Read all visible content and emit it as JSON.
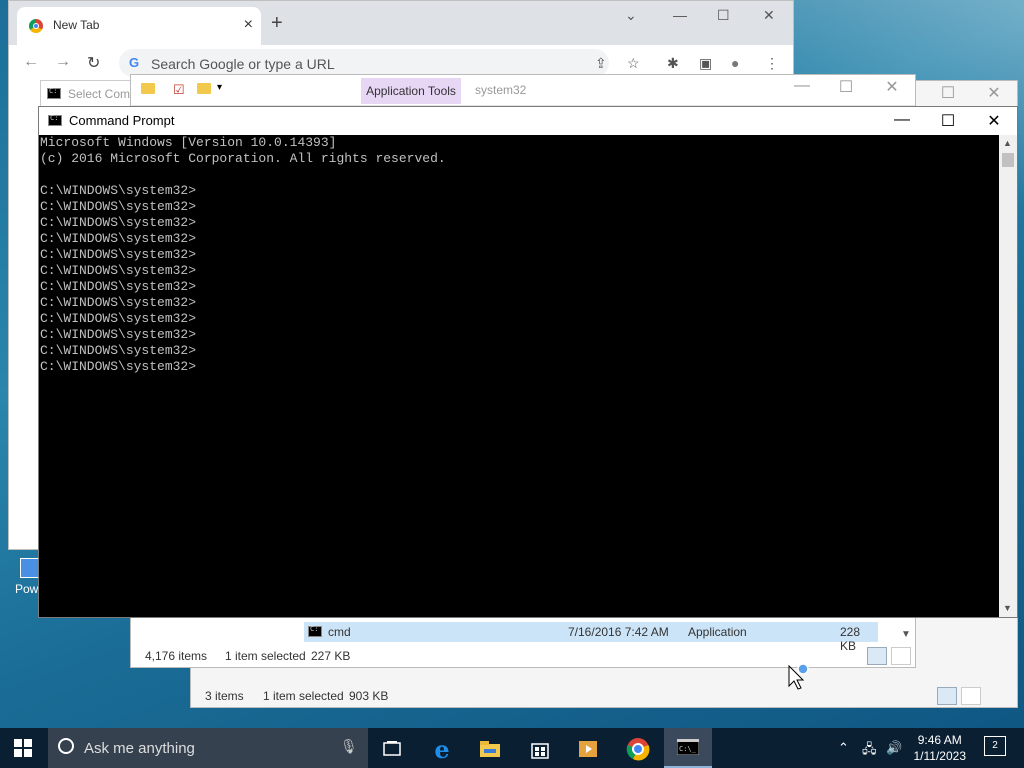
{
  "chrome": {
    "tab_title": "New Tab",
    "tab_close": "×",
    "new_tab": "+",
    "omnibox_placeholder": "Search Google or type a URL",
    "omnibox_g": "G",
    "minimize": "—",
    "maximize": "☐",
    "close": "✕",
    "chevron": "⌄",
    "back": "←",
    "forward": "→",
    "reload": "↻",
    "share": "⇪",
    "star": "☆",
    "extensions": "✱",
    "sidepanel": "▣",
    "profile": "●",
    "menu": "⋮"
  },
  "explorer_back": {
    "status_items": "3 items",
    "status_selected": "1 item selected",
    "status_size": "903 KB"
  },
  "explorer_front": {
    "ribbon_context_tab": "Application Tools",
    "ribbon_path_title": "system32",
    "status_items": "4,176 items",
    "status_selected": "1 item selected",
    "status_size": "227 KB",
    "row": {
      "name": "cmd",
      "date": "7/16/2016 7:42 AM",
      "type": "Application",
      "size": "228 KB"
    }
  },
  "select_command_title": "Select Com",
  "cmd": {
    "title": "Command Prompt",
    "minimize": "—",
    "maximize": "☐",
    "close": "✕",
    "lines": [
      "Microsoft Windows [Version 10.0.14393]",
      "(c) 2016 Microsoft Corporation. All rights reserved.",
      "",
      "C:\\WINDOWS\\system32>",
      "C:\\WINDOWS\\system32>",
      "C:\\WINDOWS\\system32>",
      "C:\\WINDOWS\\system32>",
      "C:\\WINDOWS\\system32>",
      "C:\\WINDOWS\\system32>",
      "C:\\WINDOWS\\system32>",
      "C:\\WINDOWS\\system32>",
      "C:\\WINDOWS\\system32>",
      "C:\\WINDOWS\\system32>",
      "C:\\WINDOWS\\system32>",
      "C:\\WINDOWS\\system32>"
    ]
  },
  "desktop": {
    "icon_label": "Powe"
  },
  "taskbar": {
    "search_placeholder": "Ask me anything",
    "time": "9:46 AM",
    "date": "1/11/2023",
    "notification_count": "2",
    "apps": [
      "task-view",
      "edge",
      "file-explorer",
      "store",
      "media-player",
      "chrome",
      "command-prompt"
    ]
  }
}
